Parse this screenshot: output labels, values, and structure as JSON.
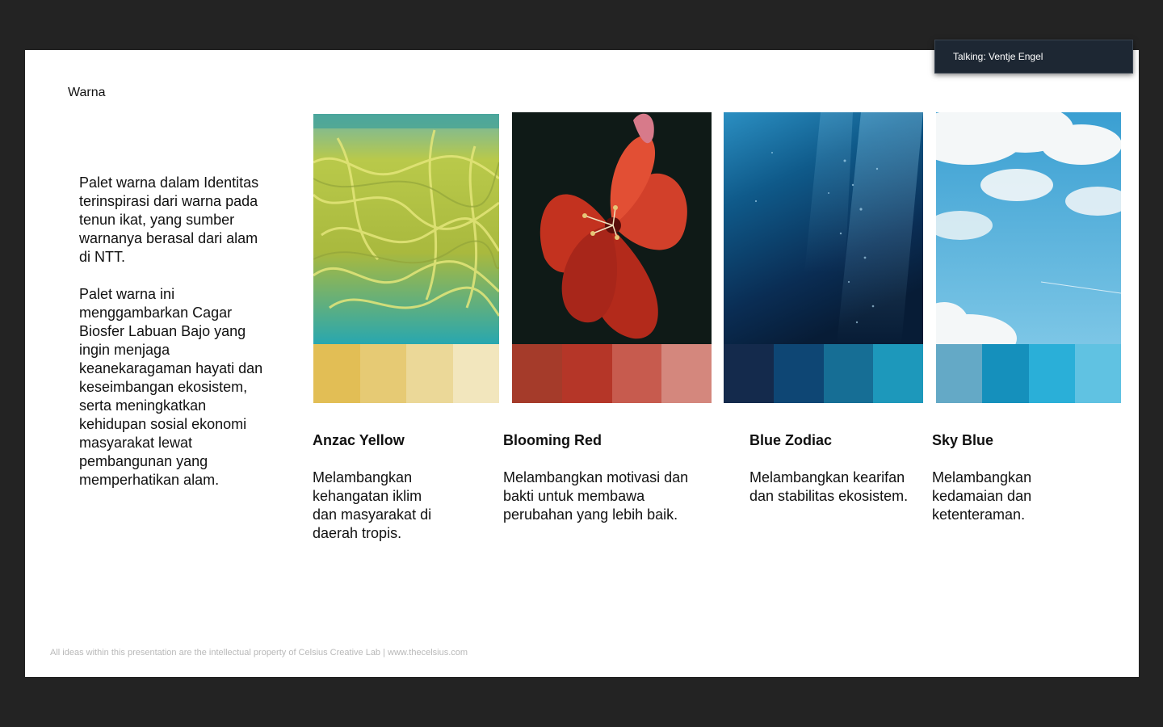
{
  "slide": {
    "title": "Warna",
    "intro_paragraphs": [
      "Palet warna dalam Identitas terinspirasi dari warna pada tenun ikat, yang sumber warnanya berasal dari alam di NTT.",
      "Palet warna ini menggambarkan Cagar Biosfer Labuan Bajo yang ingin menjaga keanekaragaman hayati dan keseimbangan ekosistem, serta meningkatkan kehidupan sosial ekonomi masyarakat lewat pembangunan yang memperhatikan alam."
    ],
    "palettes": [
      {
        "name": "Anzac Yellow",
        "description": "Melambangkan kehangatan iklim dan masyarakat di daerah tropis.",
        "photo": "seaweed-underwater",
        "swatches": [
          "#e2be55",
          "#e6ca74",
          "#ebd898",
          "#f2e6bd"
        ]
      },
      {
        "name": "Blooming Red",
        "description": "Melambangkan motivasi dan bakti untuk membawa perubahan yang lebih baik.",
        "photo": "red-flower",
        "swatches": [
          "#a53b2a",
          "#b53628",
          "#c75b4e",
          "#d4877d"
        ]
      },
      {
        "name": "Blue Zodiac",
        "description": "Melambangkan kearifan dan stabilitas ekosistem.",
        "photo": "deep-ocean",
        "swatches": [
          "#142a4c",
          "#0e4674",
          "#166e95",
          "#1d98bb"
        ]
      },
      {
        "name": "Sky Blue",
        "description": "Melambangkan kedamaian dan ketenteraman.",
        "photo": "cloudy-sky",
        "swatches": [
          "#64a9c6",
          "#1590bc",
          "#2aafd8",
          "#60c2e2"
        ]
      }
    ],
    "footer": "All ideas within this presentation are the intellectual property of Celsius Creative Lab | www.thecelsius.com"
  },
  "talking_indicator": "Talking: Ventje Engel"
}
